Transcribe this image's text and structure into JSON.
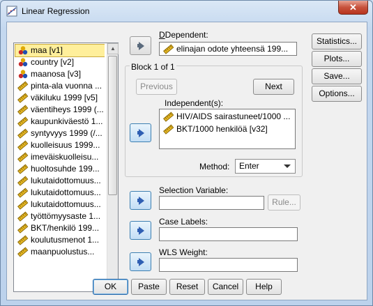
{
  "window": {
    "title": "Linear Regression",
    "close_glyph": "✕"
  },
  "variables": [
    {
      "label": "maa [v1]",
      "type": "nominal",
      "selected": true
    },
    {
      "label": "country [v2]",
      "type": "nominal"
    },
    {
      "label": "maanosa [v3]",
      "type": "nominal"
    },
    {
      "label": "pinta-ala vuonna ...",
      "type": "scale"
    },
    {
      "label": "väkiluku 1999 [v5]",
      "type": "scale"
    },
    {
      "label": "väentiheys 1999 (...",
      "type": "scale"
    },
    {
      "label": "kaupunkiväestö 1...",
      "type": "scale"
    },
    {
      "label": "syntyvyys 1999 (/...",
      "type": "scale"
    },
    {
      "label": "kuolleisuus 1999...",
      "type": "scale"
    },
    {
      "label": "imeväiskuolleisu...",
      "type": "scale"
    },
    {
      "label": "huoltosuhde 199...",
      "type": "scale"
    },
    {
      "label": "lukutaidottomuus...",
      "type": "scale"
    },
    {
      "label": "lukutaidottomuus...",
      "type": "scale"
    },
    {
      "label": "lukutaidottomuus...",
      "type": "scale"
    },
    {
      "label": "työttömyysaste 1...",
      "type": "scale"
    },
    {
      "label": "BKT/henkilö 199...",
      "type": "scale"
    },
    {
      "label": "koulutusmenot 1...",
      "type": "scale"
    },
    {
      "label": "maanpuolustus...",
      "type": "scale"
    }
  ],
  "dependent": {
    "label": "Dependent:",
    "value": "elinajan odote yhteensä 199..."
  },
  "block": {
    "title": "Block 1 of 1",
    "previous_label": "Previous",
    "next_label": "Next",
    "independents_label": "Independent(s):",
    "independents": [
      "HIV/AIDS sairastuneet/1000 ...",
      "BKT/1000 henkilöä [v32]"
    ],
    "method_label": "Method:",
    "method_value": "Enter"
  },
  "selection_variable": {
    "label": "Selection Variable:",
    "value": "",
    "rule_label": "Rule..."
  },
  "case_labels": {
    "label": "Case Labels:",
    "value": ""
  },
  "wls_weight": {
    "label": "WLS Weight:",
    "value": ""
  },
  "side_buttons": {
    "statistics": "Statistics...",
    "plots": "Plots...",
    "save": "Save...",
    "options": "Options..."
  },
  "bottom_buttons": {
    "ok": "OK",
    "paste": "Paste",
    "reset": "Reset",
    "cancel": "Cancel",
    "help": "Help"
  },
  "colors": {
    "selected_bg": "#ffef9b",
    "ruler_icon": "#d4a017",
    "accent": "#3c7fb1"
  }
}
